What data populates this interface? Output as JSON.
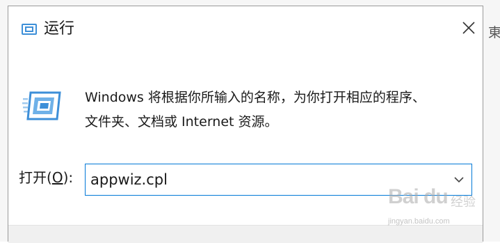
{
  "window": {
    "title": "运行",
    "close_icon": "close-icon",
    "app_icon": "run-dialog-icon"
  },
  "content": {
    "description_line1": "Windows 将根据你所输入的名称，为你打开相应的程序、",
    "description_line2": "文件夹、文档或 Internet 资源。",
    "open_label_prefix": "打开(",
    "open_label_mnemonic": "O",
    "open_label_suffix": "):",
    "input_value": "appwiz.cpl",
    "dropdown_icon": "chevron-down-icon"
  },
  "edge_text": "東",
  "watermark": {
    "brand": "Bai du",
    "sub": "经验",
    "url": "jingyan.baidu.com"
  },
  "colors": {
    "accent": "#0078d7",
    "icon_blue": "#3d8fd8",
    "text": "#1a1a1a"
  }
}
